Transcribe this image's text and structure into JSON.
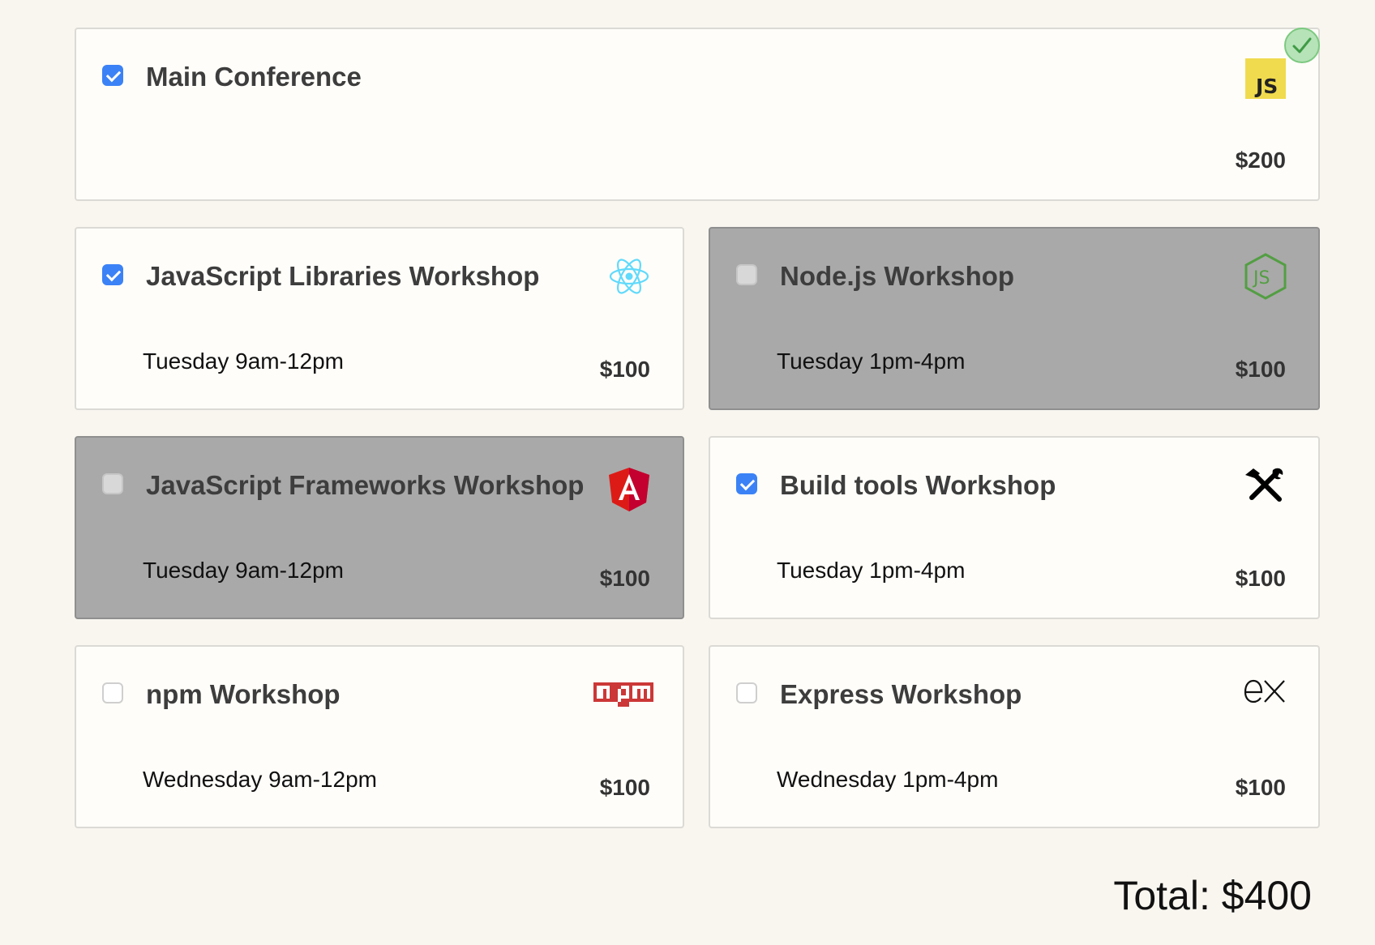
{
  "main": {
    "title": "Main Conference",
    "price": "$200",
    "checked": true,
    "icon": "js-icon",
    "status_icon": "selected-check-icon"
  },
  "workshops": [
    {
      "title": "JavaScript Libraries Workshop",
      "when": "Tuesday 9am-12pm",
      "price": "$100",
      "checked": true,
      "disabled": false,
      "icon": "react-icon"
    },
    {
      "title": "Node.js Workshop",
      "when": "Tuesday 1pm-4pm",
      "price": "$100",
      "checked": false,
      "disabled": true,
      "icon": "nodejs-icon"
    },
    {
      "title": "JavaScript Frameworks Workshop",
      "when": "Tuesday 9am-12pm",
      "price": "$100",
      "checked": false,
      "disabled": true,
      "icon": "angular-icon"
    },
    {
      "title": "Build tools Workshop",
      "when": "Tuesday 1pm-4pm",
      "price": "$100",
      "checked": true,
      "disabled": false,
      "icon": "tools-icon"
    },
    {
      "title": "npm Workshop",
      "when": "Wednesday 9am-12pm",
      "price": "$100",
      "checked": false,
      "disabled": false,
      "icon": "npm-icon"
    },
    {
      "title": "Express Workshop",
      "when": "Wednesday 1pm-4pm",
      "price": "$100",
      "checked": false,
      "disabled": false,
      "icon": "express-icon"
    }
  ],
  "total": "Total: $400",
  "colors": {
    "page_bg": "#f9f6f0",
    "card_bg": "#fffdf9",
    "disabled_bg": "#a9a9a9",
    "checkbox_checked": "#3b82f6",
    "js_yellow": "#f0db4f",
    "react_blue": "#61dafb",
    "node_green": "#539e43",
    "angular_red": "#dd1b16",
    "npm_red": "#cb3837"
  }
}
